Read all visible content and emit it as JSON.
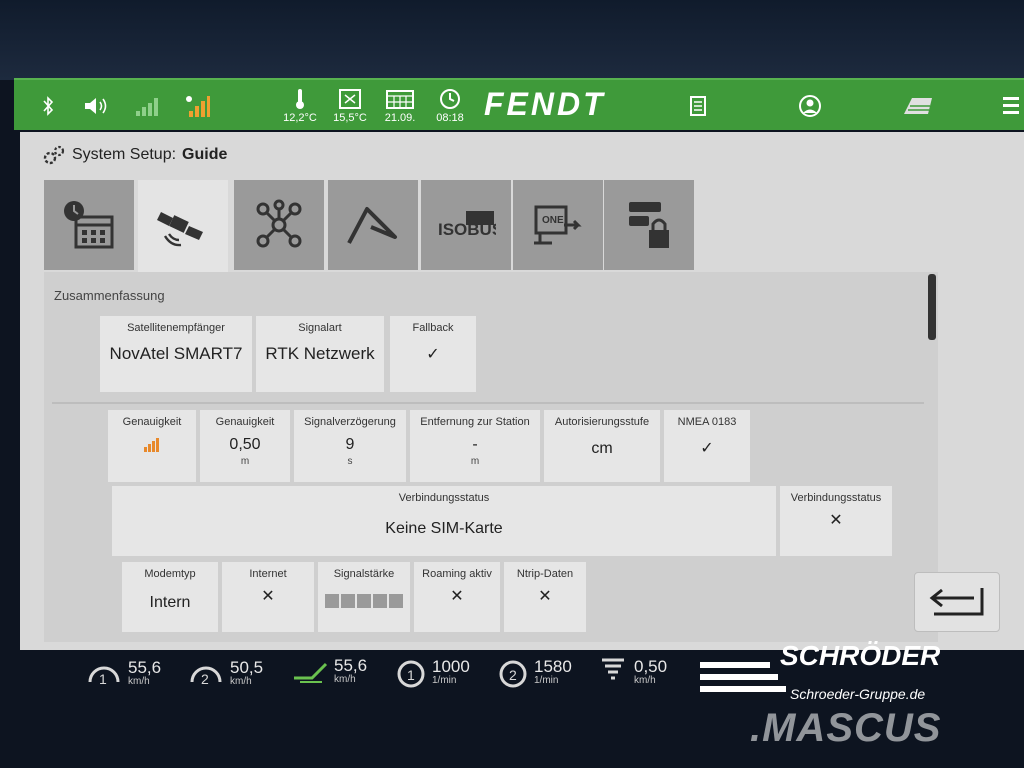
{
  "statusbar": {
    "temp_outside": "12,2°C",
    "temp_cabin": "15,5°C",
    "date": "21.09.",
    "time": "08:18",
    "brand": "FENDT"
  },
  "setup": {
    "prefix": "System Setup:",
    "name": "Guide"
  },
  "tabs": {
    "isobus_label": "ISOBUS",
    "one_label": "ONE"
  },
  "summary": {
    "section": "Zusammenfassung",
    "receiver_label": "Satellitenempfänger",
    "receiver_value": "NovAtel SMART7",
    "signaltype_label": "Signalart",
    "signaltype_value": "RTK Netzwerk",
    "fallback_label": "Fallback"
  },
  "accuracy": {
    "acc1_label": "Genauigkeit",
    "acc2_label": "Genauigkeit",
    "acc2_value": "0,50",
    "acc2_unit": "m",
    "delay_label": "Signalverzögerung",
    "delay_value": "9",
    "delay_unit": "s",
    "distance_label": "Entfernung zur Station",
    "distance_value": "-",
    "distance_unit": "m",
    "auth_label": "Autorisierungsstufe",
    "auth_value": "cm",
    "nmea_label": "NMEA 0183"
  },
  "connection": {
    "status_label": "Verbindungsstatus",
    "status_value": "Keine SIM-Karte",
    "status2_label": "Verbindungsstatus"
  },
  "modem": {
    "type_label": "Modemtyp",
    "type_value": "Intern",
    "internet_label": "Internet",
    "signal_label": "Signalstärke",
    "roaming_label": "Roaming aktiv",
    "ntrip_label": "Ntrip-Daten"
  },
  "bottombar": {
    "speed1_value": "55,6",
    "speed1_unit": "km/h",
    "speed2_value": "50,5",
    "speed2_unit": "km/h",
    "speed3_value": "55,6",
    "speed3_unit": "km/h",
    "rpm1_value": "1000",
    "rpm1_unit": "1/min",
    "rpm2_value": "1580",
    "rpm2_unit": "1/min",
    "rate_value": "0,50",
    "rate_unit": "km/h"
  },
  "watermark": {
    "name": "SCHRÖDER",
    "sub": "Schroeder-Gruppe.de",
    "mascus": ".MASCUS"
  },
  "colors": {
    "statusbar_green": "#3f9a3a",
    "check_green": "#2d8a2d",
    "cross_red": "#d63a3a"
  }
}
